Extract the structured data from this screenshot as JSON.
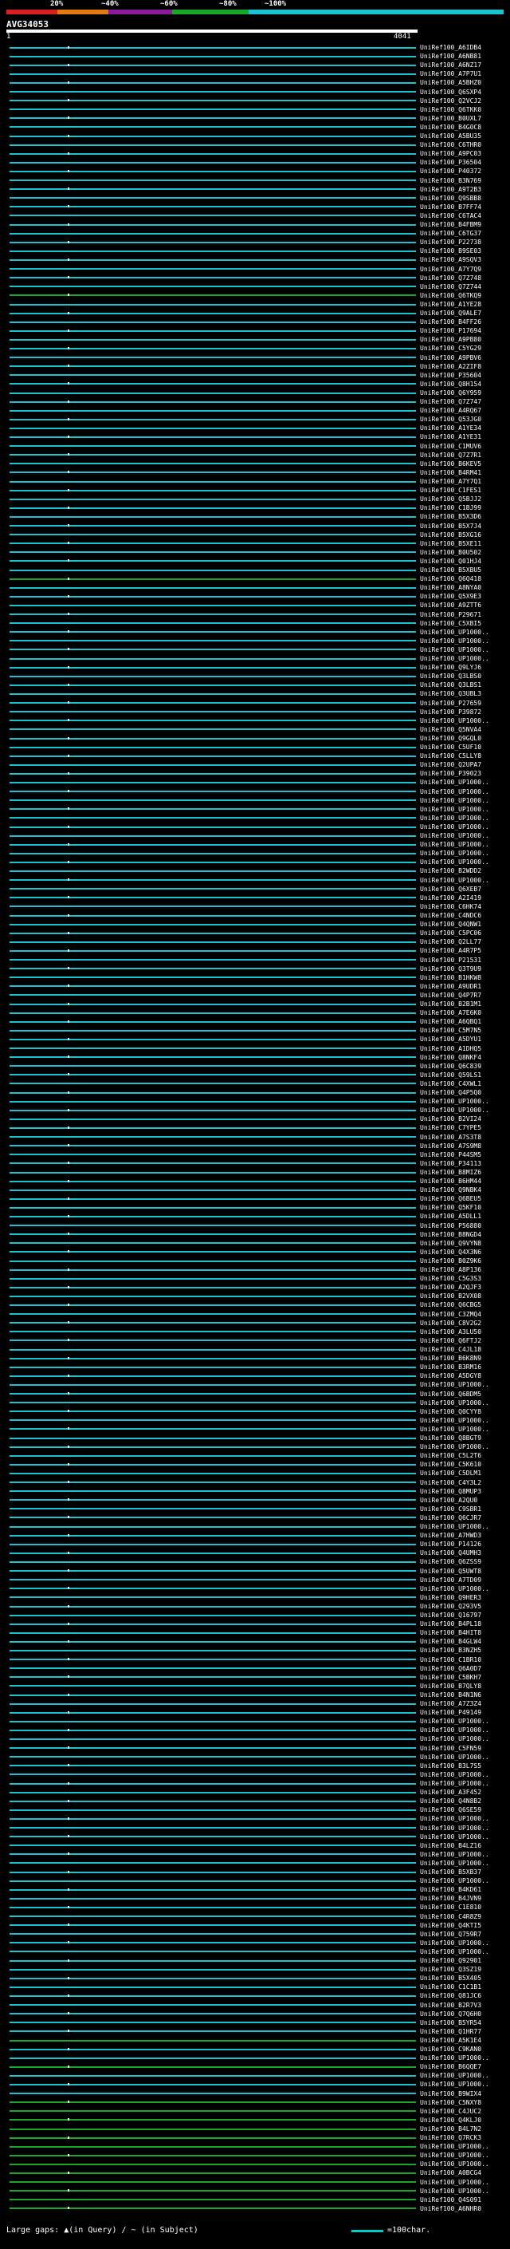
{
  "legend": {
    "segments": [
      {
        "label": "20%",
        "color": "#d91f1f"
      },
      {
        "label": "~40%",
        "color": "#e07a12"
      },
      {
        "label": "~60%",
        "color": "#8a1c9a"
      },
      {
        "label": "~80%",
        "color": "#1aa626"
      },
      {
        "label": "~100%",
        "color": "#19c3d0"
      }
    ]
  },
  "query": {
    "name": "AVG34053",
    "scale_start": "1",
    "scale_end": "4041"
  },
  "hits": {
    "colors": {
      "high": "#19c3d0",
      "mid": "#1aa626"
    },
    "labels": [
      "UniRef100_A6IDB4",
      "UniRef100_A6NB81",
      "UniRef100_A6NZ17",
      "UniRef100_A7P7U1",
      "UniRef100_A5BHZ0",
      "UniRef100_Q6SXP4",
      "UniRef100_Q2VCJ2",
      "UniRef100_Q6TKK0",
      "UniRef100_B0UXL7",
      "UniRef100_B4G0C8",
      "UniRef100_A5BU35",
      "UniRef100_C6THR0",
      "UniRef100_A9PC03",
      "UniRef100_P36504",
      "UniRef100_P40372",
      "UniRef100_B3N769",
      "UniRef100_A9T2B3",
      "UniRef100_Q9SBB8",
      "UniRef100_B7FF74",
      "UniRef100_C6TAC4",
      "UniRef100_B4FBM9",
      "UniRef100_C6TG37",
      "UniRef100_P22738",
      "UniRef100_B9SE03",
      "UniRef100_A9SQV3",
      "UniRef100_A7Y7Q9",
      "UniRef100_Q7Z748",
      "UniRef100_Q7Z744",
      "UniRef100_Q6TKQ9",
      "UniRef100_A1YE28",
      "UniRef100_Q9ALE7",
      "UniRef100_B4FF26",
      "UniRef100_P17694",
      "UniRef100_A9PB80",
      "UniRef100_C5YG29",
      "UniRef100_A9PBV6",
      "UniRef100_A2ZIF8",
      "UniRef100_P35604",
      "UniRef100_Q8H154",
      "UniRef100_Q6Y959",
      "UniRef100_Q7Z747",
      "UniRef100_A4RQ67",
      "UniRef100_Q53JG0",
      "UniRef100_A1YE34",
      "UniRef100_A1YE31",
      "UniRef100_C1MUV6",
      "UniRef100_Q7Z7R1",
      "UniRef100_B6KEV5",
      "UniRef100_B4RM41",
      "UniRef100_A7Y7Q1",
      "UniRef100_C1FES1",
      "UniRef100_Q5BJJ2",
      "UniRef100_C1BJ99",
      "UniRef100_B5X3D6",
      "UniRef100_B5X7J4",
      "UniRef100_B5XG16",
      "UniRef100_B5XE11",
      "UniRef100_B0U502",
      "UniRef100_Q01HJ4",
      "UniRef100_B5XBU5",
      "UniRef100_Q6Q418",
      "UniRef100_A8NYA0",
      "UniRef100_Q5X9E3",
      "UniRef100_A9ZTT6",
      "UniRef100_P29671",
      "UniRef100_C5XBI5",
      "UniRef100_UP1000..",
      "UniRef100_UP1000..",
      "UniRef100_UP1000..",
      "UniRef100_UP1000..",
      "UniRef100_Q9LYJ6",
      "UniRef100_Q3LBS0",
      "UniRef100_Q3LBS1",
      "UniRef100_Q3UBL3",
      "UniRef100_P27659",
      "UniRef100_P39872",
      "UniRef100_UP1000..",
      "UniRef100_Q5NVA4",
      "UniRef100_Q9GQL0",
      "UniRef100_C5UF10",
      "UniRef100_C5LLY8",
      "UniRef100_Q2UPA7",
      "UniRef100_P39023",
      "UniRef100_UP1000..",
      "UniRef100_UP1000..",
      "UniRef100_UP1000..",
      "UniRef100_UP1000..",
      "UniRef100_UP1000..",
      "UniRef100_UP1000..",
      "UniRef100_UP1000..",
      "UniRef100_UP1000..",
      "UniRef100_UP1000..",
      "UniRef100_UP1000..",
      "UniRef100_B2WDD2",
      "UniRef100_UP1000..",
      "UniRef100_Q6XEB7",
      "UniRef100_A2I419",
      "UniRef100_C6HK74",
      "UniRef100_C4NDC6",
      "UniRef100_Q4QNW1",
      "UniRef100_C5PC06",
      "UniRef100_Q2LL77",
      "UniRef100_A4R7P5",
      "UniRef100_P21531",
      "UniRef100_Q3T9U9",
      "UniRef100_B1HKW8",
      "UniRef100_A9UDR1",
      "UniRef100_Q4P7R7",
      "UniRef100_B2B1M1",
      "UniRef100_A7E6K0",
      "UniRef100_A6QBQ1",
      "UniRef100_C5M7N5",
      "UniRef100_A5DYU1",
      "UniRef100_A1DHQ5",
      "UniRef100_Q8NKF4",
      "UniRef100_Q6C839",
      "UniRef100_Q59LS1",
      "UniRef100_C4XWL1",
      "UniRef100_Q4P5Q0",
      "UniRef100_UP1000..",
      "UniRef100_UP1000..",
      "UniRef100_B2VI24",
      "UniRef100_C7YPE5",
      "UniRef100_A7S3T8",
      "UniRef100_A7S9M8",
      "UniRef100_P44SM5",
      "UniRef100_P34113",
      "UniRef100_B8MIZ6",
      "UniRef100_B6HM44",
      "UniRef100_Q9NBK4",
      "UniRef100_Q6BEU5",
      "UniRef100_Q5KF10",
      "UniRef100_A5DLL1",
      "UniRef100_P56880",
      "UniRef100_B8NGD4",
      "UniRef100_Q9VYN8",
      "UniRef100_Q4X3N6",
      "UniRef100_B0Z9K6",
      "UniRef100_A8P136",
      "UniRef100_C5G3S3",
      "UniRef100_A2QJF3",
      "UniRef100_B2VX08",
      "UniRef100_Q6CBG5",
      "UniRef100_C3ZMQ4",
      "UniRef100_C8V2G2",
      "UniRef100_A3LU50",
      "UniRef100_Q6FTJ2",
      "UniRef100_C4JL18",
      "UniRef100_B6K8N9",
      "UniRef100_B3RM16",
      "UniRef100_A5DGY8",
      "UniRef100_UP1000..",
      "UniRef100_Q6BDM5",
      "UniRef100_UP1000..",
      "UniRef100_Q0CYY8",
      "UniRef100_UP1000..",
      "UniRef100_UP1000..",
      "UniRef100_Q8BGT9",
      "UniRef100_UP1000..",
      "UniRef100_C5L2T6",
      "UniRef100_C5K610",
      "UniRef100_C5DLM1",
      "UniRef100_C4Y3L2",
      "UniRef100_Q8MUP3",
      "UniRef100_A2QU0",
      "UniRef100_C9SBR1",
      "UniRef100_Q6CJR7",
      "UniRef100_UP1000..",
      "UniRef100_A7HWD3",
      "UniRef100_P14126",
      "UniRef100_Q4UMH3",
      "UniRef100_Q6ZSS9",
      "UniRef100_Q5UWT8",
      "UniRef100_A7TD09",
      "UniRef100_UP1000..",
      "UniRef100_Q9HER3",
      "UniRef100_Q293V5",
      "UniRef100_Q16797",
      "UniRef100_B4PL18",
      "UniRef100_B4HIT8",
      "UniRef100_B4GLW4",
      "UniRef100_B3NZH5",
      "UniRef100_C1BR10",
      "UniRef100_Q6A0D7",
      "UniRef100_C5BKH7",
      "UniRef100_B7QLY8",
      "UniRef100_B4N1N6",
      "UniRef100_A7Z3Z4",
      "UniRef100_P49149",
      "UniRef100_UP1000..",
      "UniRef100_UP1000..",
      "UniRef100_UP1000..",
      "UniRef100_C5FN59",
      "UniRef100_UP1000..",
      "UniRef100_B3L7S5",
      "UniRef100_UP1000..",
      "UniRef100_UP1000..",
      "UniRef100_A3F452",
      "UniRef100_Q4N8B2",
      "UniRef100_Q6SE59",
      "UniRef100_UP1000..",
      "UniRef100_UP1000..",
      "UniRef100_UP1000..",
      "UniRef100_B4LZ16",
      "UniRef100_UP1000..",
      "UniRef100_UP1000..",
      "UniRef100_B5XB37",
      "UniRef100_UP1000..",
      "UniRef100_B4KD61",
      "UniRef100_B4JVN9",
      "UniRef100_C1E810",
      "UniRef100_C4R8Z9",
      "UniRef100_Q4KTI5",
      "UniRef100_Q759R7",
      "UniRef100_UP1000..",
      "UniRef100_UP1000..",
      "UniRef100_Q92901",
      "UniRef100_Q3SZ19",
      "UniRef100_B5X405",
      "UniRef100_C1C1B1",
      "UniRef100_Q81JC6",
      "UniRef100_B2R7V3",
      "UniRef100_Q7Q6H0",
      "UniRef100_B5YR54",
      "UniRef100_Q1HR77",
      "UniRef100_A5K1E4",
      "UniRef100_C9KAN0",
      "UniRef100_UP1000..",
      "UniRef100_B6QQE7",
      "UniRef100_UP1000..",
      "UniRef100_UP1000..",
      "UniRef100_B9WIX4",
      "UniRef100_C5NXY8",
      "UniRef100_C4JUC2",
      "UniRef100_Q4KLJ0",
      "UniRef100_B4L7N2",
      "UniRef100_Q7RCK3",
      "UniRef100_UP1000..",
      "UniRef100_UP1000..",
      "UniRef100_UP1000..",
      "UniRef100_A0BCG4",
      "UniRef100_UP1000..",
      "UniRef100_UP1000..",
      "UniRef100_Q4S091",
      "UniRef100_A6NHR0"
    ]
  },
  "footer": {
    "note": "Large gaps: ▲(in Query) / ~ (in Subject)",
    "scale_label": "=100char."
  }
}
